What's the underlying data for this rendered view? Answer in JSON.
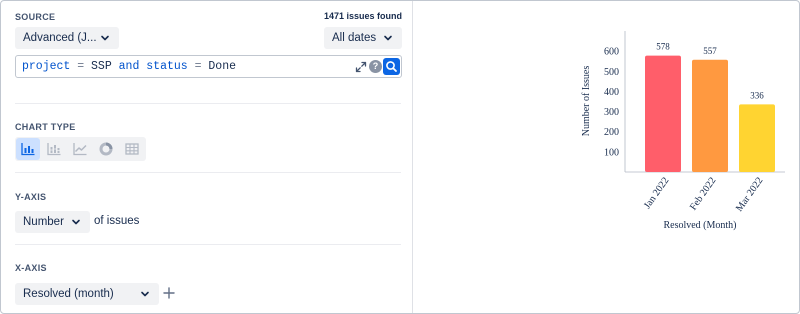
{
  "source": {
    "section_title": "SOURCE",
    "issues_found": "1471 issues found",
    "query_type": "Advanced (J...",
    "date_filter": "All dates",
    "jql": {
      "parts": [
        {
          "text": "project",
          "kind": "kw"
        },
        {
          "text": " = ",
          "kind": "op"
        },
        {
          "text": "SSP",
          "kind": "val"
        },
        {
          "text": " and ",
          "kind": "kw"
        },
        {
          "text": "status",
          "kind": "kw"
        },
        {
          "text": " = ",
          "kind": "op"
        },
        {
          "text": "Done",
          "kind": "val"
        }
      ],
      "help_glyph": "?"
    }
  },
  "chart_type": {
    "section_title": "CHART TYPE",
    "options": [
      "bar",
      "stacked-bar",
      "line",
      "donut",
      "table"
    ],
    "selected": "bar"
  },
  "y_axis": {
    "section_title": "Y-AXIS",
    "measure": "Number",
    "suffix": "of issues"
  },
  "x_axis": {
    "section_title": "X-AXIS",
    "field": "Resolved (month)"
  },
  "chart_data": {
    "type": "bar",
    "categories": [
      "Jan 2022",
      "Feb 2022",
      "Mar 2022"
    ],
    "values": [
      578,
      557,
      336
    ],
    "colors": [
      "#ff5e6a",
      "#ff9940",
      "#ffd431"
    ],
    "data_labels": [
      "578",
      "557",
      "336"
    ],
    "yticks": [
      100,
      200,
      300,
      400,
      500,
      600
    ],
    "ylim": [
      0,
      700
    ],
    "ylabel": "Number of Issues",
    "xlabel": "Resolved (Month)",
    "grid": false
  }
}
